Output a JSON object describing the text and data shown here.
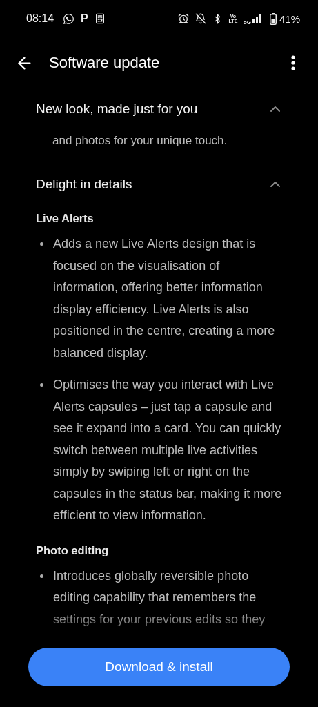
{
  "status_bar": {
    "time": "08:14",
    "app_letter": "P",
    "volte": [
      "Vo",
      "LTE"
    ],
    "network": "5G",
    "battery": "41%"
  },
  "app_bar": {
    "title": "Software update"
  },
  "sections": [
    {
      "title": "New look, made just for you",
      "expanded": true,
      "groups": [
        {
          "paragraph": "and photos for your unique touch."
        }
      ]
    },
    {
      "title": "Delight in details",
      "expanded": true,
      "groups": [
        {
          "heading": "Live Alerts",
          "bullets": [
            "Adds a new Live Alerts design that is focused on the visualisation of information, offering better information display efficiency. Live Alerts is also positioned in the centre, creating a more balanced display.",
            "Optimises the way you interact with Live Alerts capsules – just tap a capsule and see it expand into a card. You can quickly switch between multiple live activities simply by swiping left or right on the capsules in the status bar, making it more efficient to view information."
          ]
        },
        {
          "heading": "Photo editing",
          "bullets": [
            "Introduces globally reversible photo editing capability that remembers the settings for your previous edits so they"
          ]
        }
      ]
    }
  ],
  "primary_button": {
    "label": "Download & install"
  }
}
